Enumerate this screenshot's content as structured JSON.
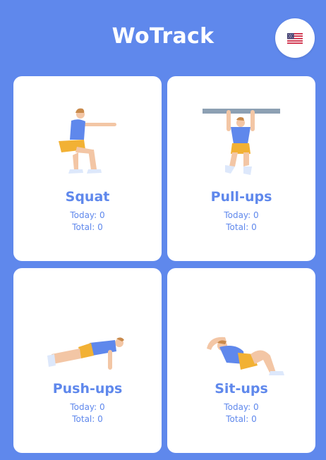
{
  "app": {
    "title": "WoTrack",
    "language_flag_icon": "us-flag-icon"
  },
  "colors": {
    "background": "#5f88ec",
    "card": "#ffffff",
    "accent_text": "#5f88ec"
  },
  "exercises": [
    {
      "name": "Squat",
      "today": "Today: 0",
      "total": "Total: 0",
      "icon": "squat-illustration-icon"
    },
    {
      "name": "Pull-ups",
      "today": "Today: 0",
      "total": "Total: 0",
      "icon": "pull-ups-illustration-icon"
    },
    {
      "name": "Push-ups",
      "today": "Today: 0",
      "total": "Total: 0",
      "icon": "push-ups-illustration-icon"
    },
    {
      "name": "Sit-ups",
      "today": "Today: 0",
      "total": "Total: 0",
      "icon": "sit-ups-illustration-icon"
    }
  ]
}
